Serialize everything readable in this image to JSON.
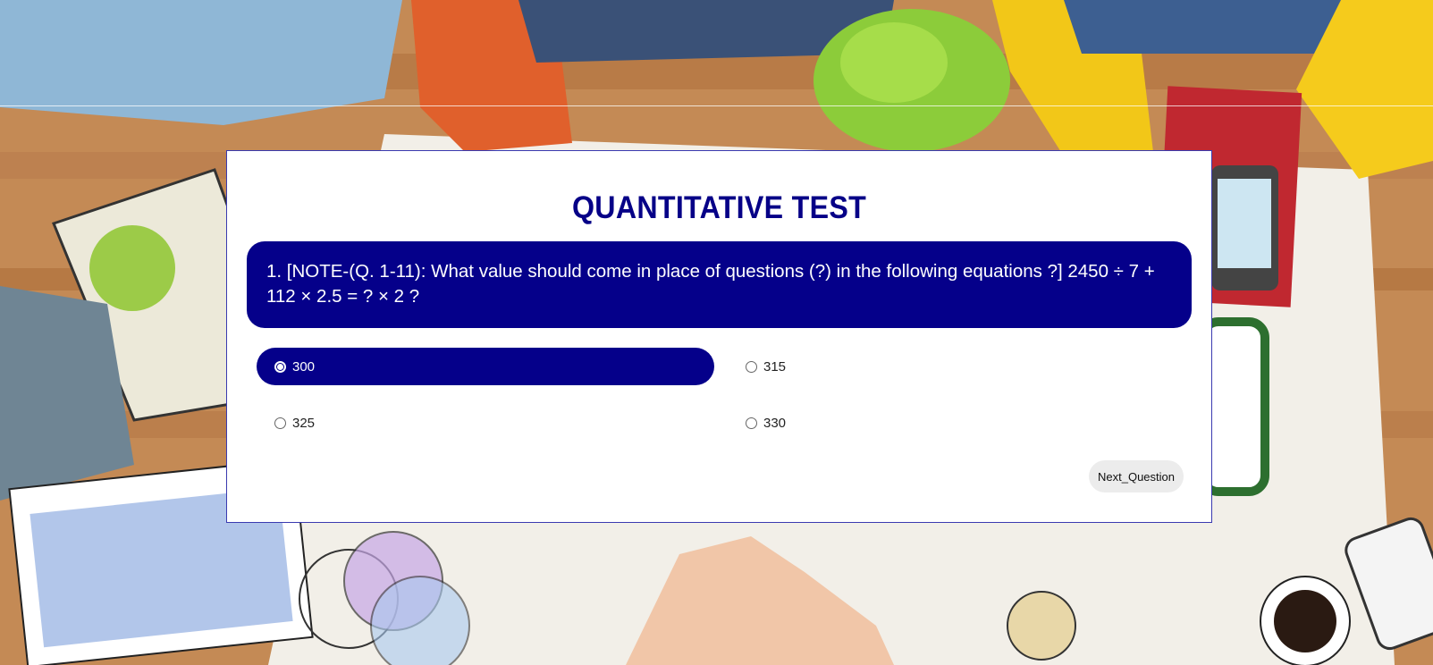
{
  "quiz": {
    "title": "QUANTITATIVE TEST",
    "question_text": "1. [NOTE-(Q. 1-11): What value should come in place of questions (?) in the following equations ?] 2450 ÷ 7 + 112 × 2.5 = ? × 2 ?",
    "options": [
      {
        "label": "300",
        "selected": true
      },
      {
        "label": "315",
        "selected": false
      },
      {
        "label": "325",
        "selected": false
      },
      {
        "label": "330",
        "selected": false
      }
    ],
    "next_button_label": "Next_Question"
  },
  "colors": {
    "accent": "#05008a",
    "card_background": "#ffffff",
    "button_background": "#ececec"
  }
}
